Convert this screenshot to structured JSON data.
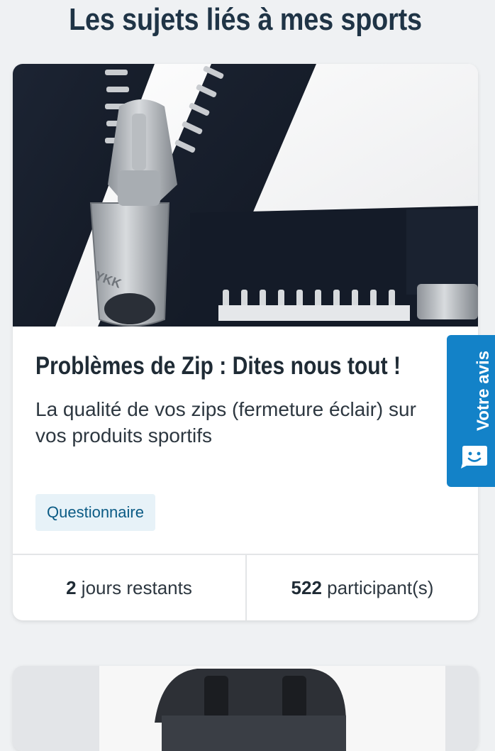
{
  "section": {
    "title": "Les sujets liés à mes sports"
  },
  "card": {
    "image_alt": "YKK zip close-up",
    "zipper_brand": "YKK",
    "title": "Problèmes de Zip : Dites nous tout !",
    "description": "La qualité de vos zips (fermeture éclair) sur vos produits sportifs",
    "tag": "Questionnaire",
    "footer": {
      "remaining_number": "2",
      "remaining_label": " jours restants",
      "participants_number": "522",
      "participants_label": " participant(s)"
    }
  },
  "feedback": {
    "label": "Votre avis",
    "icon": "smiley-bubble-icon"
  },
  "card2": {
    "image_alt": "black sports bag"
  },
  "colors": {
    "background": "#eff1f3",
    "heading": "#1f3446",
    "accent_blue": "#1382c8",
    "tag_bg": "#e7f2f8",
    "tag_text": "#0b5b85"
  }
}
